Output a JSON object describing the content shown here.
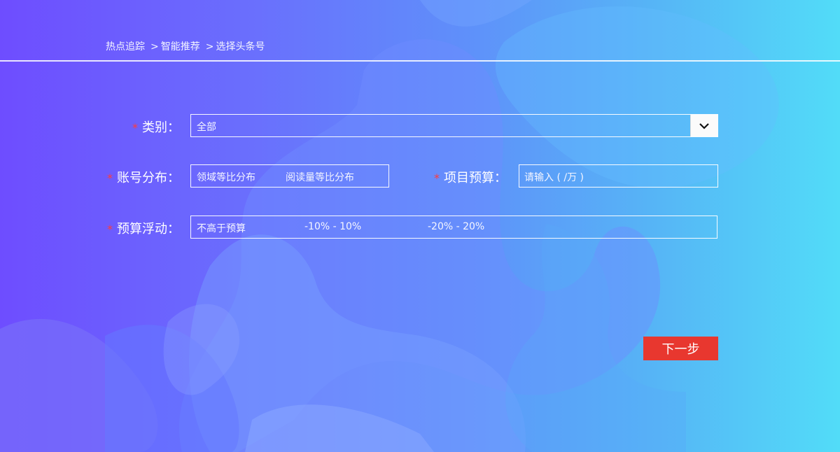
{
  "breadcrumb": {
    "item1": "热点追踪",
    "item2": "智能推荐",
    "item3": "选择头条号",
    "separator": ">"
  },
  "form": {
    "required_mark": "*",
    "category": {
      "label": "类别：",
      "value": "全部"
    },
    "account_distribution": {
      "label": "账号分布：",
      "option1": "领域等比分布",
      "option2": "阅读量等比分布"
    },
    "project_budget": {
      "label": "项目预算：",
      "placeholder": "请输入 ( /万 )"
    },
    "budget_float": {
      "label": "预算浮动：",
      "option1": "不高于预算",
      "option2": "-10% - 10%",
      "option3": "-20% - 20%"
    }
  },
  "next_button": {
    "label": "下一步"
  },
  "colors": {
    "gradient_start": "#6e4dff",
    "gradient_end": "#52dcf8",
    "accent_button": "#e8372f",
    "required": "#ff3b3b"
  }
}
